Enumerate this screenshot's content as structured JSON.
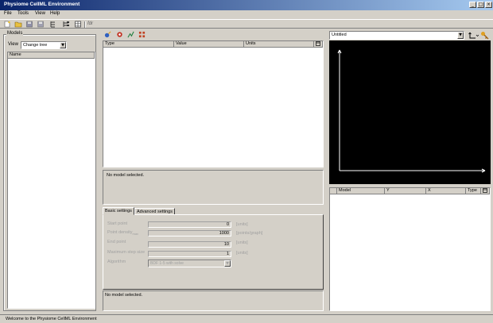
{
  "window": {
    "title": "Physiome CellML Environment",
    "minimize": "_",
    "maximize": "□",
    "close": "×"
  },
  "menu": [
    "File",
    "Tools",
    "View",
    "Help"
  ],
  "toolbar": {
    "fdr_label": "fdr"
  },
  "models_panel": {
    "group_label": "Models",
    "view_label": "View",
    "view_value": "Change tree",
    "column_name": "Name"
  },
  "variables_table": {
    "columns": [
      "Type",
      "Value",
      "Units"
    ]
  },
  "info_text": "No model selected.",
  "tabs": [
    "Basic settings",
    "Advanced settings"
  ],
  "settings": {
    "start_point": {
      "label": "Start point",
      "value": "0",
      "unit": "[units]"
    },
    "point_density": {
      "label": "Point density",
      "label_sub": "max",
      "value": "1000",
      "unit": "[points/graph]"
    },
    "end_point": {
      "label": "End point",
      "value": "10",
      "unit": "[units]"
    },
    "max_step": {
      "label": "Maximum step size",
      "value": "1",
      "unit": "[units]"
    },
    "algorithm": {
      "label": "Algorithm",
      "value": "BDF 1-5 with solve"
    }
  },
  "settings_status": "No model selected.",
  "graph": {
    "selector_value": "Untitled",
    "background": "#000000"
  },
  "trace_table": {
    "columns": [
      "Model",
      "Y",
      "X",
      "Type"
    ]
  },
  "statusbar": "Welcome to the Physiome CellML Environment"
}
